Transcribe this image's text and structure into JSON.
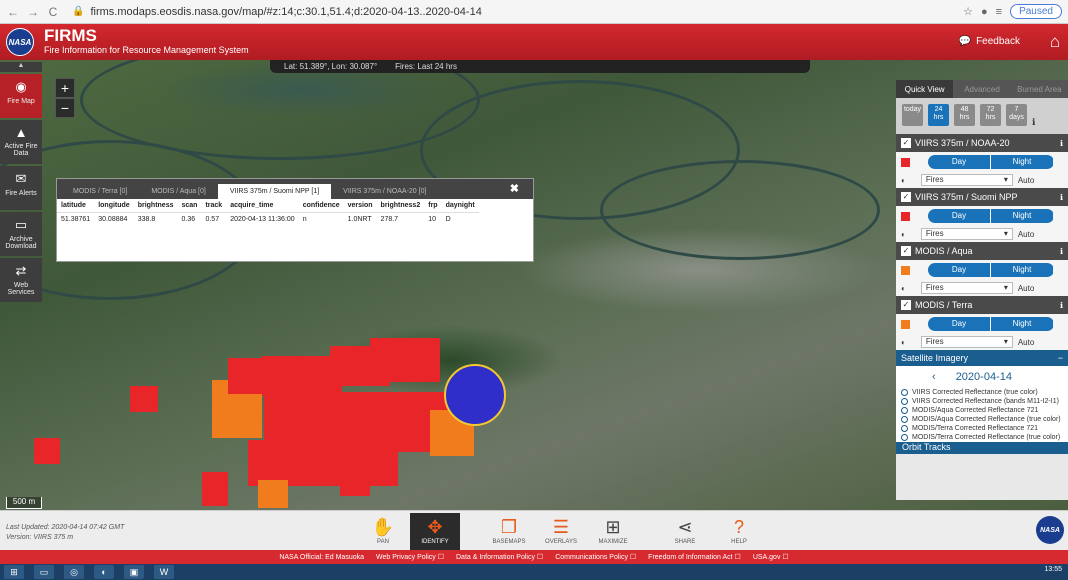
{
  "browser": {
    "back_icon": "arrow-left-icon",
    "url": "firms.modaps.eosdis.nasa.gov/map/#z:14;c:30.1,51.4;d:2020-04-13..2020-04-14",
    "paused": "Paused"
  },
  "header": {
    "logo": "NASA",
    "title": "FIRMS",
    "subtitle": "Fire Information for Resource Management System",
    "feedback": "Feedback"
  },
  "map_info": {
    "latlon": "Lat: 51.389°, Lon: 30.087°",
    "fires": "Fires: Last 24 hrs"
  },
  "scale": "500 m",
  "sidenav": {
    "items": [
      {
        "label": "Fire Map"
      },
      {
        "label": "Active Fire Data"
      },
      {
        "label": "Fire Alerts"
      },
      {
        "label": "Archive Download"
      },
      {
        "label": "Web Services"
      }
    ]
  },
  "popup": {
    "tabs": [
      "MODIS / Terra [0]",
      "MODIS / Aqua [0]",
      "VIIRS 375m / Suomi NPP [1]",
      "VIIRS 375m / NOAA-20 [0]"
    ],
    "columns": [
      "latitude",
      "longitude",
      "brightness",
      "scan",
      "track",
      "acquire_time",
      "confidence",
      "version",
      "brightness2",
      "frp",
      "daynight"
    ],
    "row": [
      "51.38761",
      "30.08884",
      "338.8",
      "0.36",
      "0.57",
      "2020-04-13 11:36:00",
      "n",
      "1.0NRT",
      "278.7",
      "10",
      "D"
    ]
  },
  "panel": {
    "tabs": [
      "Quick View",
      "Advanced",
      "Burned Area"
    ],
    "times": [
      {
        "top": "today",
        "bottom": ""
      },
      {
        "top": "24",
        "bottom": "hrs"
      },
      {
        "top": "48",
        "bottom": "hrs"
      },
      {
        "top": "72",
        "bottom": "hrs"
      },
      {
        "top": "7",
        "bottom": "days"
      }
    ],
    "layers": [
      {
        "name": "VIIRS 375m / NOAA-20",
        "swatch": "#e8262a",
        "day": "Day",
        "night": "Night",
        "type": "Fires",
        "auto": "Auto"
      },
      {
        "name": "VIIRS 375m / Suomi NPP",
        "swatch": "#e8262a",
        "day": "Day",
        "night": "Night",
        "type": "Fires",
        "auto": "Auto"
      },
      {
        "name": "MODIS / Aqua",
        "swatch": "#f07c1d",
        "day": "Day",
        "night": "Night",
        "type": "Fires",
        "auto": "Auto"
      },
      {
        "name": "MODIS / Terra",
        "swatch": "#f07c1d",
        "day": "Day",
        "night": "Night",
        "type": "Fires",
        "auto": "Auto"
      }
    ],
    "satellite_title": "Satellite Imagery",
    "date": "2020-04-14",
    "imagery": [
      "VIIRS Corrected Reflectance (true color)",
      "VIIRS Corrected Reflectance (bands M11-I2-I1)",
      "MODIS/Aqua Corrected Reflectance 721",
      "MODIS/Aqua Corrected Reflectance (true color)",
      "MODIS/Terra Corrected Reflectance 721",
      "MODIS/Terra Corrected Reflectance (true color)"
    ],
    "orbit": "Orbit Tracks"
  },
  "bottom": {
    "last_updated": "Last Updated: 2020-04-14 07:42 GMT",
    "version": "Version: VIIRS 375 m",
    "tools": [
      "PAN",
      "IDENTIFY",
      "BASEMAPS",
      "OVERLAYS",
      "MAXIMIZE",
      "SHARE",
      "HELP"
    ]
  },
  "footer": {
    "links": [
      "NASA Official: Ed Masuoka",
      "Web Privacy Policy ☐",
      "Data & Information Policy ☐",
      "Communications Policy ☐",
      "Freedom of Information Act ☐",
      "USA.gov ☐"
    ]
  },
  "taskbar": {
    "time": "13:55"
  }
}
